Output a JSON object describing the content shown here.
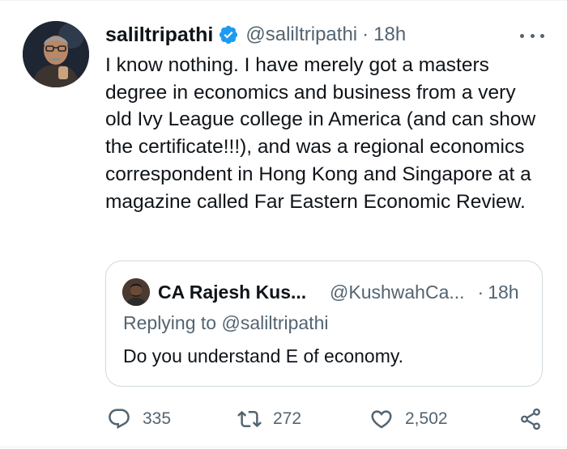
{
  "tweet": {
    "author_name": "saliltripathi",
    "handle": "@saliltripathi",
    "separator": "·",
    "time": "18h",
    "text": "I know nothing. I have merely got a masters degree in economics and business from a very old Ivy League college in America (and can show the certificate!!!), and was a regional economics correspondent in Hong Kong and Singapore at a magazine called Far Eastern Economic Review."
  },
  "quoted_tweet": {
    "author_name": "CA Rajesh Kus...",
    "handle": "@KushwahCa...",
    "separator": "·",
    "time": "18h",
    "replying_prefix": "Replying to",
    "replying_to": "@saliltripathi",
    "text": "Do you understand E of economy."
  },
  "actions": {
    "replies": "335",
    "retweets": "272",
    "likes": "2,502"
  },
  "icons": {
    "verified": "verified-badge-icon",
    "more": "more-options-icon",
    "reply": "reply-icon",
    "retweet": "retweet-icon",
    "like": "heart-icon",
    "share": "share-icon"
  },
  "colors": {
    "text_primary": "#0f1419",
    "text_secondary": "#536471",
    "verified_blue": "#1d9bf0",
    "border": "#cfd9de"
  }
}
